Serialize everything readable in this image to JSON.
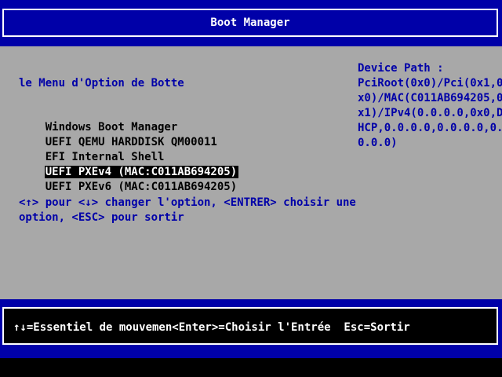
{
  "header": {
    "title": "Boot Manager"
  },
  "menu": {
    "heading": "le Menu d'Option de Botte",
    "items": [
      "Windows Boot Manager",
      "UEFI QEMU HARDDISK QM00011",
      "EFI Internal Shell",
      "UEFI PXEv4 (MAC:C011AB694205)",
      "UEFI PXEv6 (MAC:C011AB694205)"
    ],
    "selected_index": 3,
    "help_line_1": "<↑> pour <↓> changer l'option, <ENTRER> choisir une",
    "help_line_2": "option, <ESC> pour sortir"
  },
  "device_path": {
    "label": "Device Path :",
    "lines": [
      "PciRoot(0x0)/Pci(0x1,0",
      "x0)/MAC(C011AB694205,0",
      "x1)/IPv4(0.0.0.0,0x0,D",
      "HCP,0.0.0.0,0.0.0.0,0.",
      "0.0.0)"
    ]
  },
  "footer": {
    "hint": "↑↓=Essentiel de mouvemen<Enter>=Choisir l'Entrée  Esc=Sortir"
  },
  "colors": {
    "header_blue": "#0000a8",
    "panel_gray": "#a8a8a8",
    "text_blue": "#0000a8",
    "text_white": "#ffffff",
    "selection_bg": "#000000"
  }
}
